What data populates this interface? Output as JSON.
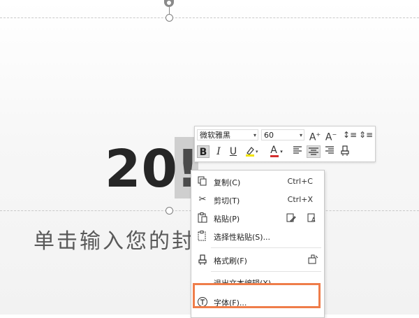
{
  "slide": {
    "title_main": "20",
    "title_selected": "!",
    "subtitle": "单击输入您的封"
  },
  "mini_toolbar": {
    "font_name": "微软雅黑",
    "font_size": "60",
    "icons": [
      "grow-font-icon",
      "shrink-font-icon",
      "line-spacing-icon",
      "paragraph-spacing-icon",
      "bold-icon",
      "italic-icon",
      "underline-icon",
      "highlight-icon",
      "font-color-icon",
      "align-left-icon",
      "align-center-icon",
      "align-right-icon",
      "format-painter-icon"
    ],
    "bold_label": "B",
    "italic_label": "I",
    "underline_label": "U",
    "font_color_label": "A",
    "highlight_color": "#f2e400",
    "font_color": "#d32f2f"
  },
  "context_menu": {
    "items": [
      {
        "label": "复制(C)",
        "shortcut": "Ctrl+C",
        "icon": "copy-icon"
      },
      {
        "label": "剪切(T)",
        "shortcut": "Ctrl+X",
        "icon": "cut-icon"
      },
      {
        "label": "粘贴(P)",
        "shortcut": "",
        "icon": "paste-icon"
      },
      {
        "label": "选择性粘贴(S)...",
        "shortcut": "",
        "icon": "paste-special-icon"
      },
      {
        "label": "格式刷(F)",
        "shortcut": "",
        "icon": "format-painter-icon"
      },
      {
        "label": "退出文本编辑(X)",
        "shortcut": "",
        "icon": ""
      },
      {
        "label": "字体(F)...",
        "shortcut": "",
        "icon": "font-dialog-icon"
      }
    ],
    "highlight_color": "#ef7d4a"
  }
}
